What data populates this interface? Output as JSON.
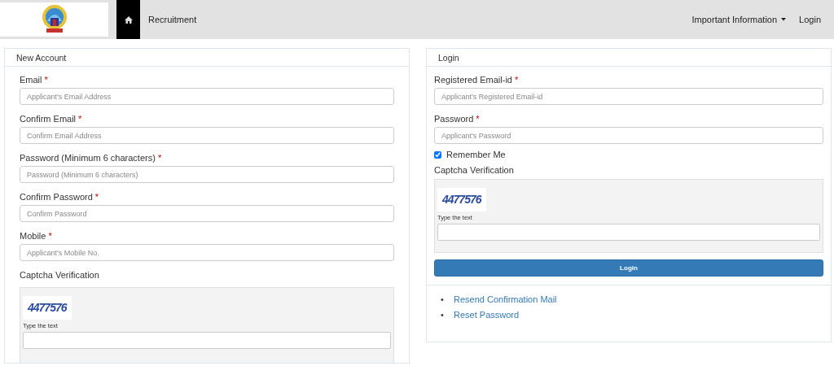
{
  "navbar": {
    "brand": "Recruitment",
    "menu": [
      {
        "label": "Important Information",
        "kind": "dropdown"
      },
      {
        "label": "Login",
        "kind": "link"
      }
    ]
  },
  "new_account": {
    "title": "New Account",
    "fields": [
      {
        "label": "Email",
        "required_mark": "*",
        "placeholder": "Applicant's Email Address"
      },
      {
        "label": "Confirm Email",
        "required_mark": "*",
        "placeholder": "Confirm Email Address"
      },
      {
        "label": "Password (Minimum 6 characters)",
        "required_mark": "*",
        "placeholder": "Password (Minimum 6 characters)"
      },
      {
        "label": "Confirm Password",
        "required_mark": "*",
        "placeholder": "Confirm Password"
      },
      {
        "label": "Mobile",
        "required_mark": "*",
        "placeholder": "Applicant's Mobile No."
      }
    ],
    "captcha": {
      "heading": "Captcha Verification",
      "code": "4477576",
      "prompt": "Type the text"
    }
  },
  "login": {
    "title": "Login",
    "fields": [
      {
        "label": "Registered Email-id",
        "required_mark": "*",
        "placeholder": "Applicant's Registered Email-id"
      },
      {
        "label": "Password",
        "required_mark": "*",
        "placeholder": "Applicant's Password"
      }
    ],
    "remember": {
      "label": "Remember Me",
      "checked": true
    },
    "captcha": {
      "heading": "Captcha Verification",
      "code": "4477576",
      "prompt": "Type the text"
    },
    "button": "Login",
    "links": [
      {
        "bullet": "•",
        "label": "Resend Confirmation Mail"
      },
      {
        "bullet": "•",
        "label": "Reset Password"
      }
    ]
  }
}
